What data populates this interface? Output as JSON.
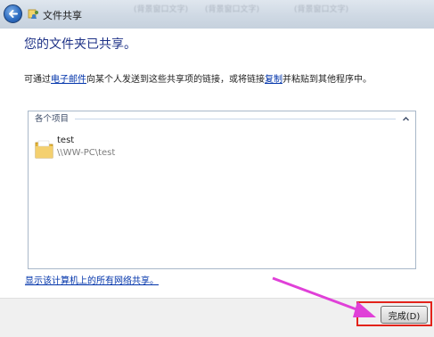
{
  "window": {
    "title": "文件共享",
    "background_ghost_texts": [
      "(背景窗口文字)",
      "(背景窗口文字)",
      "(背景窗口文字)"
    ]
  },
  "main": {
    "heading": "您的文件夹已共享。",
    "description_before_link1": "可通过",
    "link_email": "电子邮件",
    "description_middle": "向某个人发送到这些共享项的链接，或将链接",
    "link_copy": "复制",
    "description_after_link2": "并粘贴到其他程序中。"
  },
  "list": {
    "group_header": "各个项目",
    "items": [
      {
        "name": "test",
        "path": "\\\\WW-PC\\test"
      }
    ]
  },
  "links": {
    "show_all_shares": "显示该计算机上的所有网络共享。"
  },
  "footer": {
    "finish_label": "完成(D)"
  },
  "colors": {
    "heading": "#1e3287",
    "link": "#0033aa",
    "highlight_box": "#e3231b",
    "annotation_arrow": "#e040d8"
  },
  "icons": {
    "back": "back-arrow-icon",
    "window": "file-sharing-icon",
    "folder": "folder-icon",
    "collapse": "chevron-up-icon"
  }
}
